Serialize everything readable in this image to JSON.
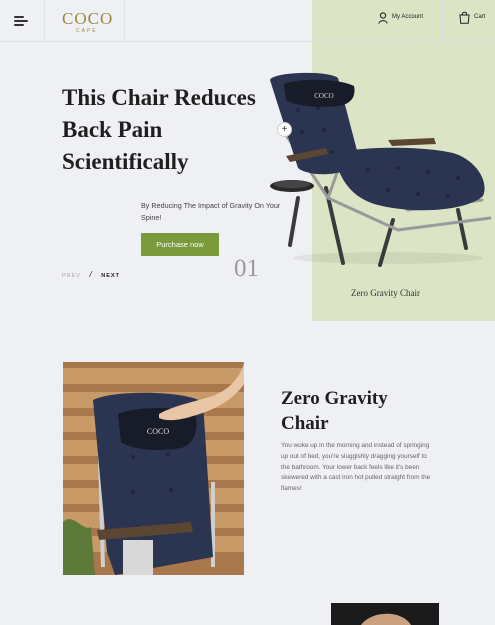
{
  "header": {
    "logo": "COCO",
    "logo_sub": "CAPE",
    "account_label": "My Account",
    "cart_label": "Cart",
    "menu_icon": "hamburger-icon",
    "account_icon": "user-icon",
    "cart_icon": "shopping-bag-icon"
  },
  "hero": {
    "title": "This Chair Reduces Back Pain Scientifically",
    "subtitle": "By Reducing The Impact of Gravity On Your Spine!",
    "button_label": "Purchase now",
    "prev_label": "PREV",
    "separator": "/",
    "next_label": "NEXT",
    "slide_number": "01",
    "plus_label": "+",
    "caption": "Zero Gravity Chair",
    "pillow_logo": "COCO"
  },
  "feature": {
    "title": "Zero Gravity Chair",
    "body": "You woke up in the morning and instead of springing up out of bed, you're sluggishly dragging yourself to the bathroom. Your lower back feels like it's been skewered with a cast iron hot pulled straight from the flames!",
    "pillow_logo": "COCO"
  },
  "colors": {
    "background": "#eff0f4",
    "hero_panel": "#dbe4c5",
    "button": "#7a9a3c",
    "logo": "#9d8a3e",
    "cushion": "#2b3450"
  }
}
